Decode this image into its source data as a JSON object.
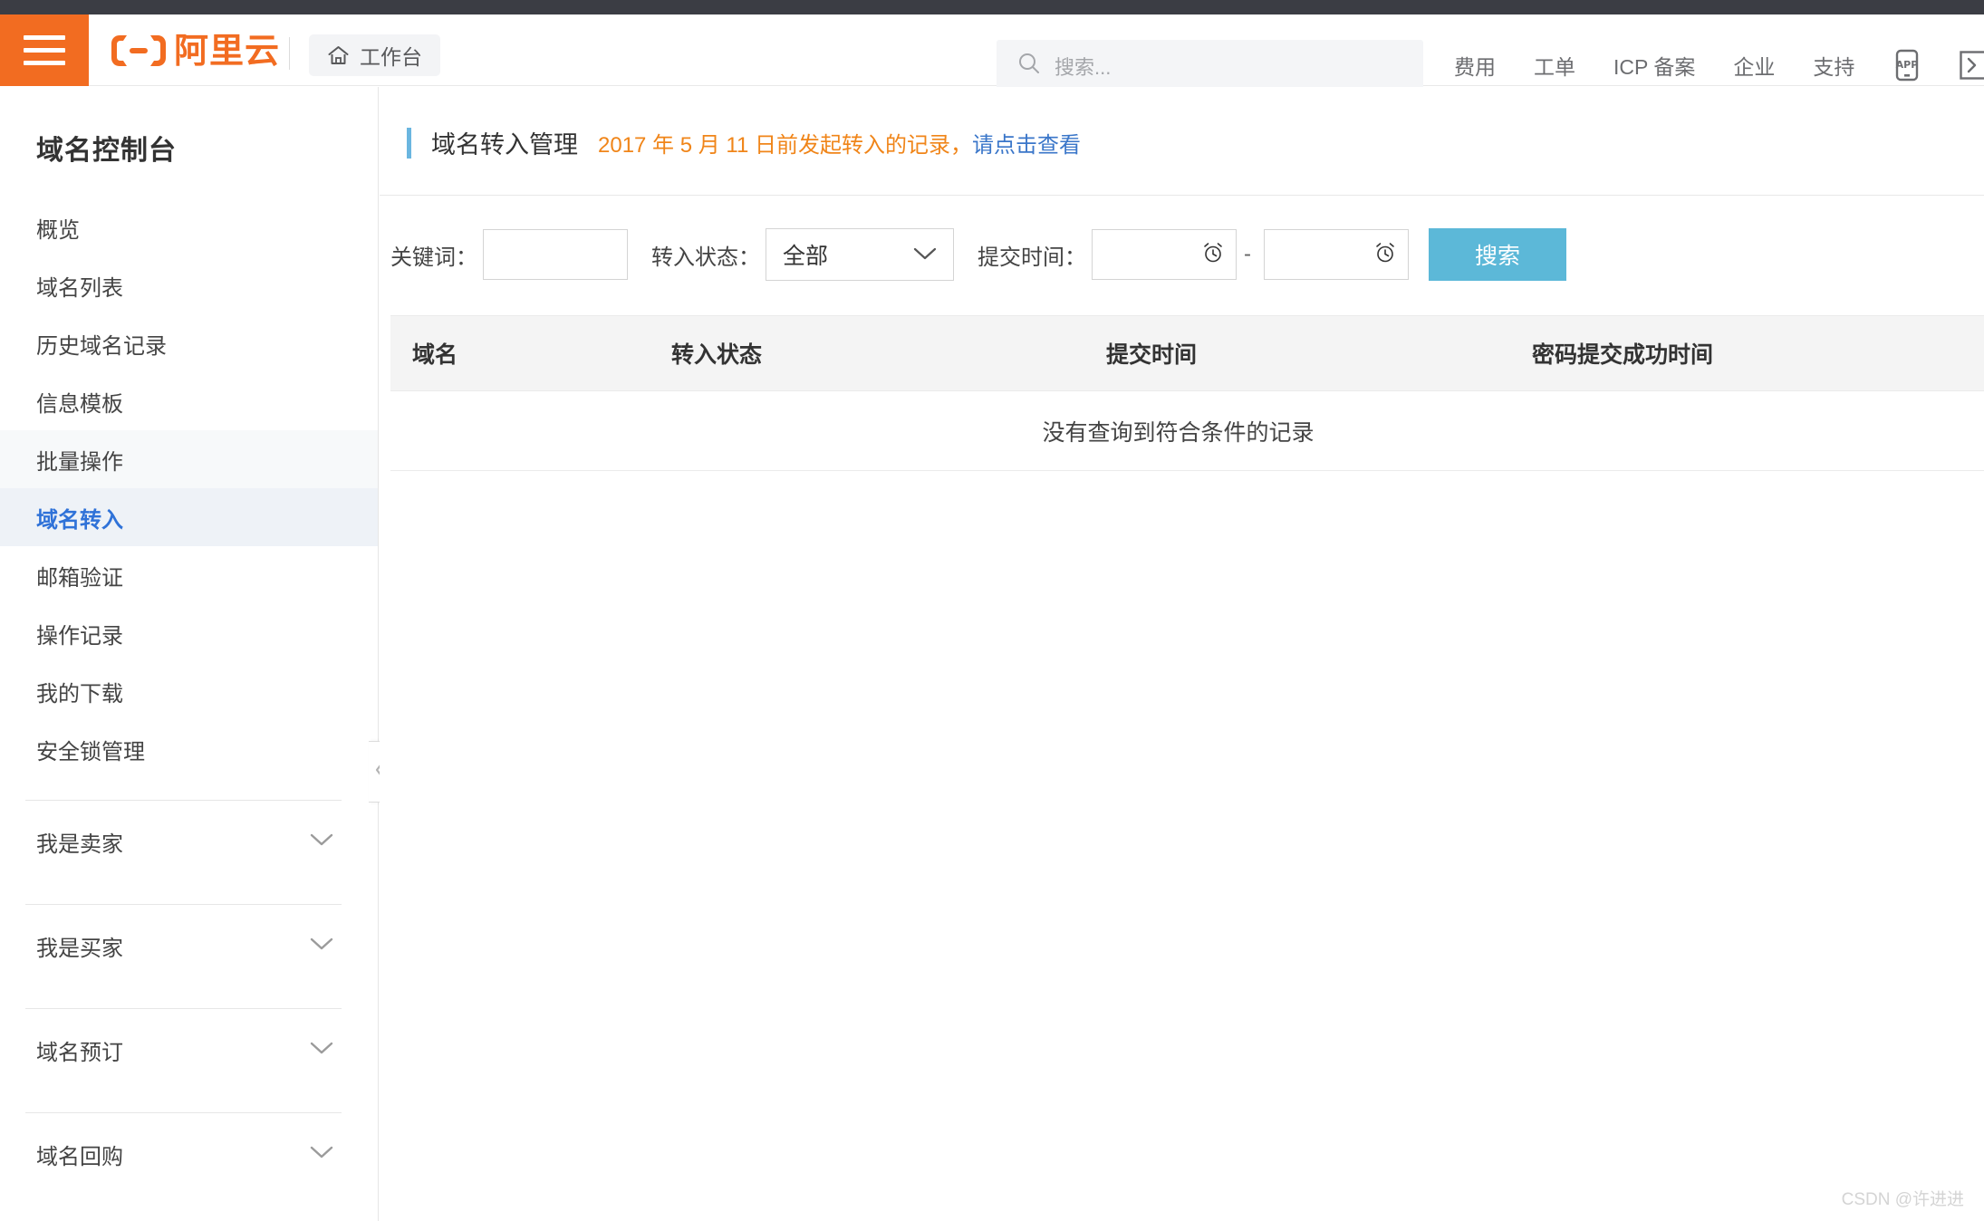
{
  "header": {
    "hamburger_icon": "hamburger-menu-icon",
    "logo_text": "阿里云",
    "logo_icon": "alibaba-cloud-logo-icon",
    "workbench_label": "工作台",
    "home_icon": "home-icon",
    "search": {
      "icon": "search-icon",
      "placeholder": "搜索..."
    },
    "nav": [
      {
        "label": "费用"
      },
      {
        "label": "工单"
      },
      {
        "label": "ICP 备案"
      },
      {
        "label": "企业"
      },
      {
        "label": "支持"
      }
    ],
    "icons": [
      {
        "name": "app-download-icon",
        "label": "APP"
      },
      {
        "name": "cloud-shell-icon",
        "label": ">_"
      }
    ]
  },
  "sidebar": {
    "title": "域名控制台",
    "items": [
      {
        "label": "概览",
        "state": "normal"
      },
      {
        "label": "域名列表",
        "state": "normal"
      },
      {
        "label": "历史域名记录",
        "state": "normal"
      },
      {
        "label": "信息模板",
        "state": "normal"
      },
      {
        "label": "批量操作",
        "state": "hover"
      },
      {
        "label": "域名转入",
        "state": "active"
      },
      {
        "label": "邮箱验证",
        "state": "normal"
      },
      {
        "label": "操作记录",
        "state": "normal"
      },
      {
        "label": "我的下载",
        "state": "normal"
      },
      {
        "label": "安全锁管理",
        "state": "normal"
      }
    ],
    "groups": [
      {
        "label": "我是卖家",
        "icon": "chevron-down-icon"
      },
      {
        "label": "我是买家",
        "icon": "chevron-down-icon"
      },
      {
        "label": "域名预订",
        "icon": "chevron-down-icon"
      },
      {
        "label": "域名回购",
        "icon": "chevron-down-icon"
      }
    ],
    "collapse_icon": "chevron-left-icon"
  },
  "page": {
    "title": "域名转入管理",
    "notice_text": "2017 年 5 月 11 日前发起转入的记录，",
    "notice_link": "请点击查看"
  },
  "filter": {
    "keyword_label": "关键词：",
    "keyword_value": "",
    "keyword_placeholder": "",
    "status_label": "转入状态：",
    "status_value": "全部",
    "status_options": [
      "全部"
    ],
    "status_icon": "chevron-down-icon",
    "time_label": "提交时间：",
    "time_start_value": "",
    "time_end_value": "",
    "time_separator": "-",
    "time_icon": "alarm-clock-icon",
    "search_button": "搜索"
  },
  "table": {
    "columns": [
      "域名",
      "转入状态",
      "提交时间",
      "密码提交成功时间"
    ],
    "rows": [],
    "empty_text": "没有查询到符合条件的记录"
  },
  "watermark": "CSDN @许进进",
  "colors": {
    "brand_orange": "#f26c21",
    "accent_blue": "#5cb8d8",
    "active_blue": "#2f72d8",
    "notice_orange": "#f08519",
    "link_blue": "#3a76c9"
  }
}
